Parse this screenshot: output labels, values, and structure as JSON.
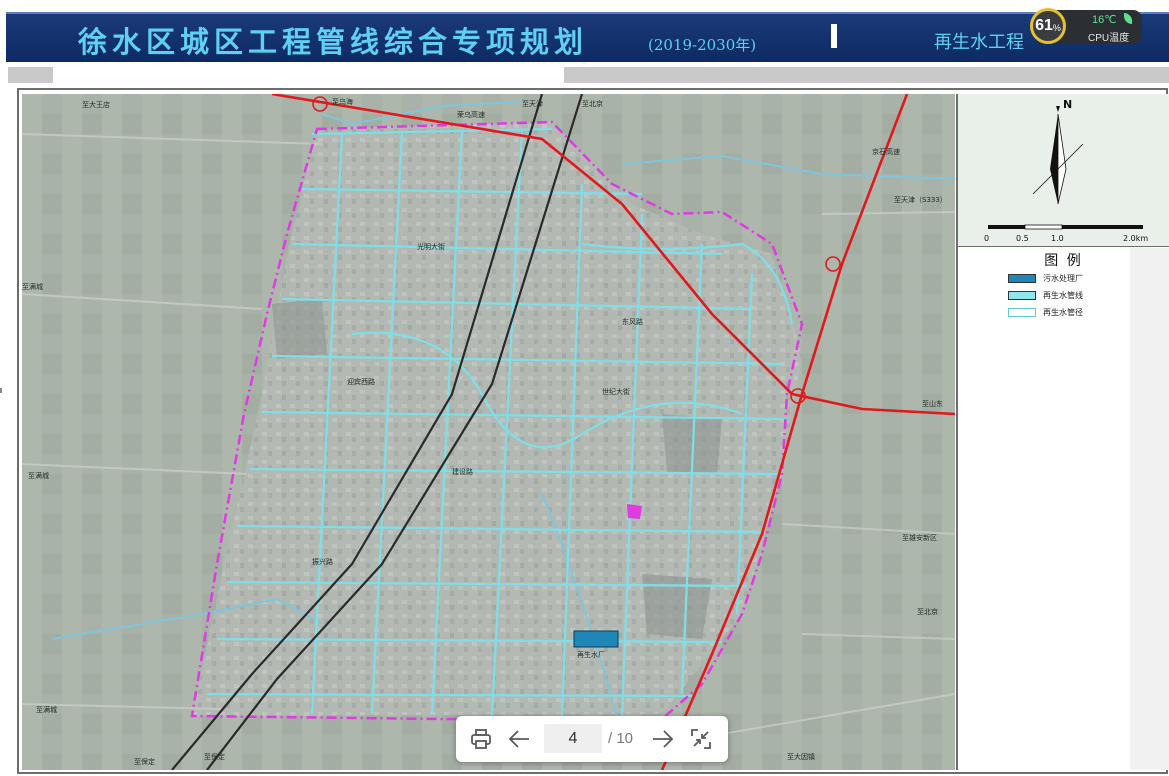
{
  "banner": {
    "title": "徐水区城区工程管线综合专项规划",
    "years": "(2019-2030年)",
    "sheet_title": "再生水工程"
  },
  "cpu_widget": {
    "percent": "61",
    "percent_sign": "%",
    "temperature": "16℃",
    "label": "CPU温度"
  },
  "map_labels": {
    "to_dawangdian": "至大王店",
    "to_wuhai": "至乌海",
    "rongwu_highway": "荣乌高速",
    "to_tianjin": "至天津",
    "to_beijing_top": "至北京",
    "to_tianjin_s333": "至天津（S333）",
    "beijing_shijiazhuang_highway": "京石高速",
    "to_mancheng_upper": "至满城",
    "to_mancheng_middle": "至满城",
    "to_mancheng_lower": "至满城",
    "to_shandong": "至山东",
    "to_xiongan": "至雄安新区",
    "to_beijing_right": "至北京",
    "to_dayinzhen": "至大因镇",
    "to_baoding": "至保定",
    "to_baoding_lower": "至保定",
    "guangming_road": "光明大街",
    "xinyi_road": "迎宾西路",
    "shixian_road": "世纪大街",
    "jiangcheng_road": "建设路",
    "road_label_a": "东风路",
    "road_label_b": "振兴路",
    "wastewater_plant_label": "再生水厂"
  },
  "compass": {
    "north": "N"
  },
  "scale_bar": {
    "labels": [
      "0",
      "0.5",
      "1.0",
      "2.0km"
    ]
  },
  "legend": {
    "title": "图 例",
    "items": [
      {
        "label": "污水处理厂",
        "color": "#1f87b8"
      },
      {
        "label": "再生水管线",
        "color": "#8fe6ee"
      },
      {
        "label": "再生水管径",
        "color": "#ffffff"
      }
    ]
  },
  "pager": {
    "current_page": "4",
    "total": "/ 10"
  },
  "colors": {
    "banner": "#0d2a63",
    "title_text": "#5fd0f2",
    "pipe": "#7fdfe8",
    "boundary": "#e03be3",
    "highway": "#e0191c"
  }
}
